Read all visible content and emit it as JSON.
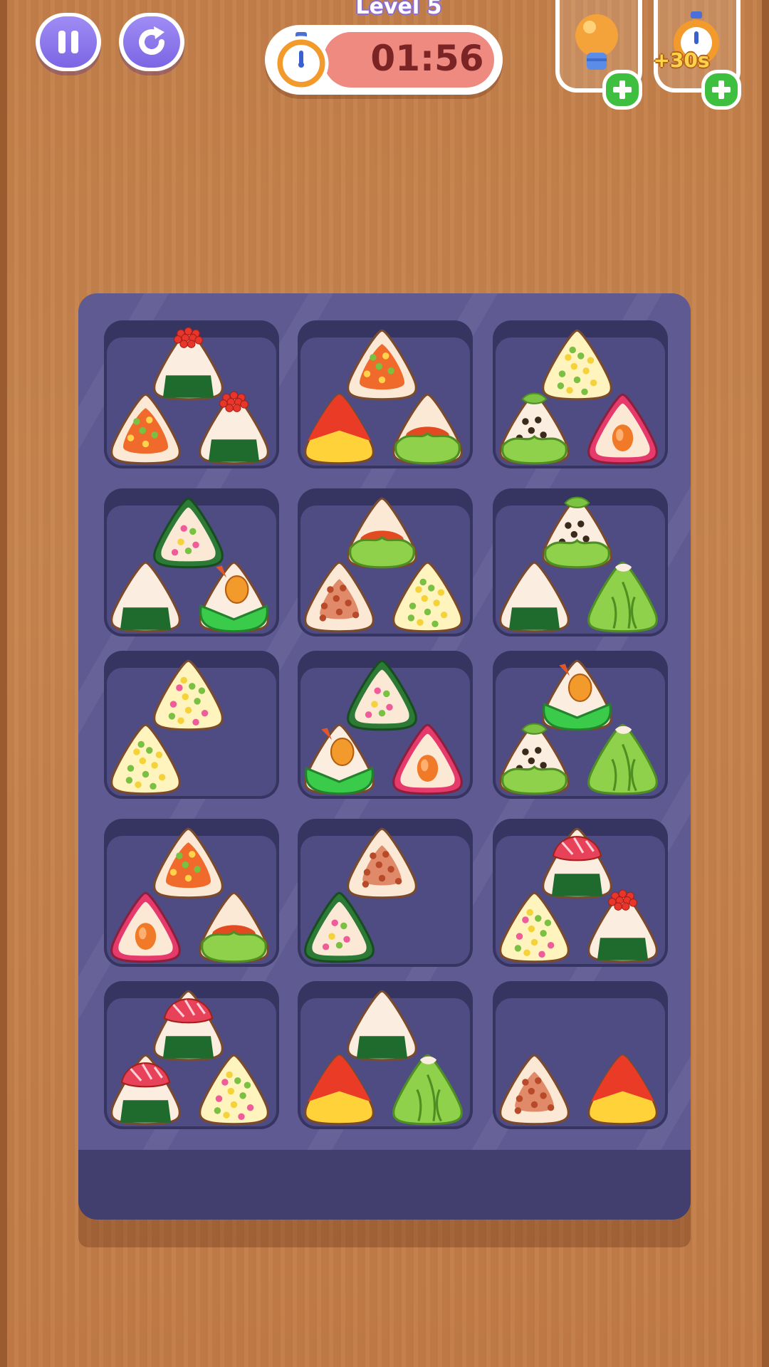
{
  "hud": {
    "level_title": "Level 5",
    "timer": "01:56",
    "pause_icon": "pause-icon",
    "restart_icon": "restart-icon",
    "timer_icon": "stopwatch-icon",
    "boosters": [
      {
        "icon": "lightbulb-icon",
        "label": "",
        "add_icon": "plus-icon"
      },
      {
        "icon": "stopwatch-icon",
        "label": "+30s",
        "add_icon": "plus-icon"
      }
    ]
  },
  "colors": {
    "wood": "#c27f4a",
    "tray": "#5f5a92",
    "slot": "#4f4c84",
    "button_purple": "#8c78ec",
    "timer_red": "#ee8a80",
    "plus_green": "#3fbf3f"
  },
  "board": {
    "rows": 5,
    "cols": 3,
    "shelves": [
      {
        "items": [
          "ikura-nori-onigiri",
          "spicy-tuna-onigiri",
          "ikura-nori-onigiri"
        ]
      },
      {
        "items": [
          "spicy-tuna-onigiri",
          "tomato-egg-onigiri",
          "lettuce-wrap-onigiri"
        ]
      },
      {
        "items": [
          "corn-peas-onigiri",
          "sesame-leaf-onigiri",
          "salmon-pink-onigiri"
        ]
      },
      {
        "items": [
          "veggie-nori-wrap-onigiri",
          "plain-nori-onigiri",
          "shrimp-green-onigiri"
        ]
      },
      {
        "items": [
          "lettuce-wrap-onigiri",
          "meat-floss-onigiri",
          "corn-peas-onigiri"
        ]
      },
      {
        "items": [
          "sesame-leaf-onigiri",
          "plain-nori-onigiri",
          "cabbage-onigiri"
        ]
      },
      {
        "items": [
          "pink-veggie-onigiri",
          "corn-peas-onigiri"
        ]
      },
      {
        "items": [
          "veggie-nori-wrap-onigiri",
          "shrimp-green-onigiri",
          "salmon-pink-onigiri"
        ]
      },
      {
        "items": [
          "shrimp-green-onigiri",
          "sesame-leaf-onigiri",
          "cabbage-onigiri"
        ]
      },
      {
        "items": [
          "spicy-tuna-onigiri",
          "salmon-pink-onigiri",
          "lettuce-wrap-onigiri"
        ]
      },
      {
        "items": [
          "meat-floss-onigiri",
          "veggie-nori-wrap-onigiri"
        ]
      },
      {
        "items": [
          "tuna-sashimi-onigiri",
          "pink-veggie-onigiri",
          "ikura-nori-onigiri"
        ]
      },
      {
        "items": [
          "tuna-sashimi-onigiri",
          "tuna-sashimi-onigiri",
          "pink-veggie-onigiri"
        ]
      },
      {
        "items": [
          "plain-nori-onigiri",
          "tomato-egg-onigiri",
          "cabbage-onigiri"
        ]
      },
      {
        "items": [
          "tomato-egg-onigiri",
          "meat-floss-onigiri"
        ]
      }
    ]
  }
}
